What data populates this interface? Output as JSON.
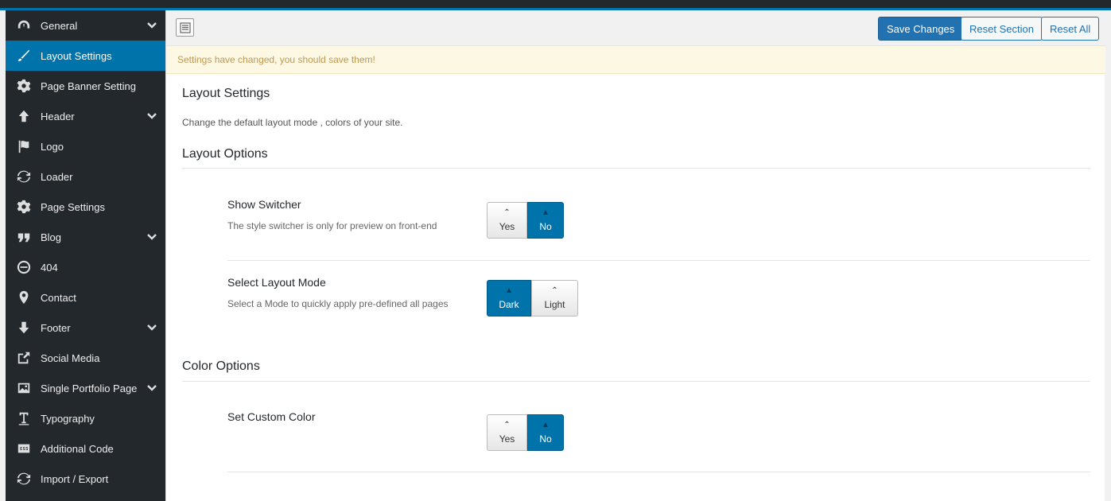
{
  "sidebar": {
    "items": [
      {
        "label": "General",
        "icon": "dashboard-icon",
        "has_children": true,
        "active": false
      },
      {
        "label": "Layout Settings",
        "icon": "brush-icon",
        "has_children": false,
        "active": true
      },
      {
        "label": "Page Banner Setting",
        "icon": "gear-icon",
        "has_children": false,
        "active": false
      },
      {
        "label": "Header",
        "icon": "arrow-up-icon",
        "has_children": true,
        "active": false
      },
      {
        "label": "Logo",
        "icon": "flag-icon",
        "has_children": false,
        "active": false
      },
      {
        "label": "Loader",
        "icon": "refresh-icon",
        "has_children": false,
        "active": false
      },
      {
        "label": "Page Settings",
        "icon": "gear-icon",
        "has_children": false,
        "active": false
      },
      {
        "label": "Blog",
        "icon": "quote-icon",
        "has_children": true,
        "active": false
      },
      {
        "label": "404",
        "icon": "minus-circle-icon",
        "has_children": false,
        "active": false
      },
      {
        "label": "Contact",
        "icon": "location-pin-icon",
        "has_children": false,
        "active": false
      },
      {
        "label": "Footer",
        "icon": "arrow-down-icon",
        "has_children": true,
        "active": false
      },
      {
        "label": "Social Media",
        "icon": "share-icon",
        "has_children": false,
        "active": false
      },
      {
        "label": "Single Portfolio Page",
        "icon": "image-icon",
        "has_children": true,
        "active": false
      },
      {
        "label": "Typography",
        "icon": "text-icon",
        "has_children": false,
        "active": false
      },
      {
        "label": "Additional Code",
        "icon": "css-icon",
        "has_children": false,
        "active": false
      },
      {
        "label": "Import / Export",
        "icon": "refresh-icon",
        "has_children": false,
        "active": false
      }
    ]
  },
  "toolbar": {
    "save_label": "Save Changes",
    "reset_section_label": "Reset Section",
    "reset_all_label": "Reset All"
  },
  "notice": "Settings have changed, you should save them!",
  "page": {
    "title": "Layout Settings",
    "description": "Change the default layout mode , colors of your site."
  },
  "sections": {
    "layout": {
      "title": "Layout Options",
      "show_switcher": {
        "title": "Show Switcher",
        "subtitle": "The style switcher is only for preview on front-end",
        "option_yes": "Yes",
        "option_no": "No",
        "selected": "No"
      },
      "layout_mode": {
        "title": "Select Layout Mode",
        "subtitle": "Select a Mode to quickly apply pre-defined all pages",
        "option_dark": "Dark",
        "option_light": "Light",
        "selected": "Dark"
      }
    },
    "color": {
      "title": "Color Options",
      "custom_color": {
        "title": "Set Custom Color",
        "option_yes": "Yes",
        "option_no": "No",
        "selected": "No"
      }
    }
  },
  "colors": {
    "accent": "#0073aa",
    "sidebar_bg": "#23282d",
    "notice_text": "#c09853"
  }
}
